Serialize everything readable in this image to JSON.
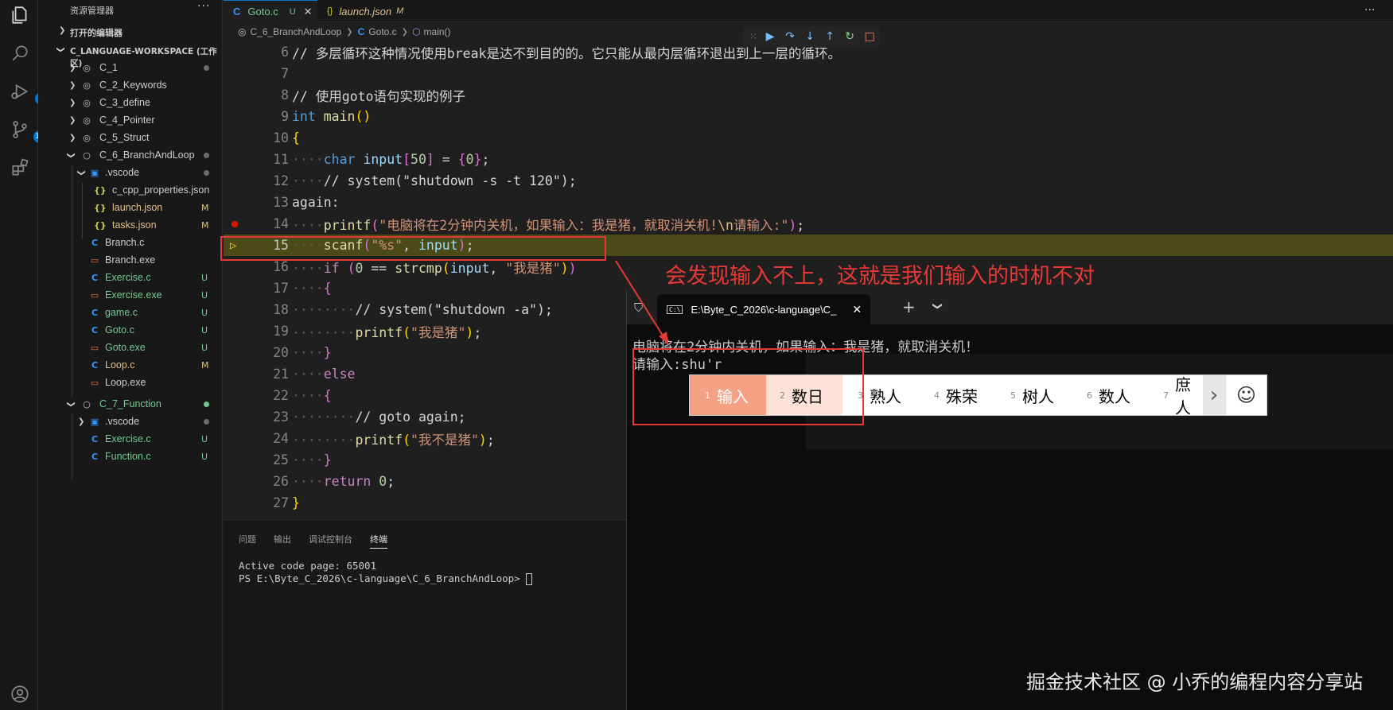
{
  "sidebar": {
    "title": "资源管理器",
    "more": "···",
    "open_editors": "打开的编辑器",
    "workspace": "C_LANGUAGE-WORKSPACE (工作区)",
    "items": [
      {
        "label": "C_1",
        "status": ""
      },
      {
        "label": "C_2_Keywords",
        "status": ""
      },
      {
        "label": "C_3_define",
        "status": ""
      },
      {
        "label": "C_4_Pointer",
        "status": ""
      },
      {
        "label": "C_5_Struct",
        "status": ""
      },
      {
        "label": "C_6_BranchAndLoop",
        "status": ""
      },
      {
        "label": ".vscode",
        "status": ""
      },
      {
        "label": "c_cpp_properties.json",
        "status": ""
      },
      {
        "label": "launch.json",
        "status": "M"
      },
      {
        "label": "tasks.json",
        "status": "M"
      },
      {
        "label": "Branch.c",
        "status": ""
      },
      {
        "label": "Branch.exe",
        "status": ""
      },
      {
        "label": "Exercise.c",
        "status": "U"
      },
      {
        "label": "Exercise.exe",
        "status": "U"
      },
      {
        "label": "game.c",
        "status": "U"
      },
      {
        "label": "Goto.c",
        "status": "U"
      },
      {
        "label": "Goto.exe",
        "status": "U"
      },
      {
        "label": "Loop.c",
        "status": "M"
      },
      {
        "label": "Loop.exe",
        "status": ""
      },
      {
        "label": "C_7_Function",
        "status": ""
      },
      {
        "label": ".vscode",
        "status": ""
      },
      {
        "label": "Exercise.c",
        "status": "U"
      },
      {
        "label": "Function.c",
        "status": "U"
      }
    ]
  },
  "activity": {
    "debug_badge": "1",
    "scm_badge": "15"
  },
  "tabs": [
    {
      "label": "Goto.c",
      "status": "U"
    },
    {
      "label": "launch.json",
      "status": "M"
    }
  ],
  "breadcrumb": {
    "folder": "C_6_BranchAndLoop",
    "file": "Goto.c",
    "symbol": "main()"
  },
  "code": [
    {
      "ln": "6",
      "text": "// 多层循环这种情况使用break是达不到目的的。它只能从最内层循环退出到上一层的循环。"
    },
    {
      "ln": "7",
      "text": ""
    },
    {
      "ln": "8",
      "text": "// 使用goto语句实现的例子"
    },
    {
      "ln": "9",
      "text": "int main()"
    },
    {
      "ln": "10",
      "text": "{"
    },
    {
      "ln": "11",
      "text": "    char input[50] = {0};"
    },
    {
      "ln": "12",
      "text": "    // system(\"shutdown -s -t 120\");"
    },
    {
      "ln": "13",
      "text": "again:"
    },
    {
      "ln": "14",
      "text": "    printf(\"电脑将在2分钟内关机，如果输入：我是猪，就取消关机!\\n请输入:\");"
    },
    {
      "ln": "15",
      "text": "    scanf(\"%s\", input);"
    },
    {
      "ln": "16",
      "text": "    if (0 == strcmp(input, \"我是猪\"))"
    },
    {
      "ln": "17",
      "text": "    {"
    },
    {
      "ln": "18",
      "text": "        // system(\"shutdown -a\");"
    },
    {
      "ln": "19",
      "text": "        printf(\"我是猪\");"
    },
    {
      "ln": "20",
      "text": "    }"
    },
    {
      "ln": "21",
      "text": "    else"
    },
    {
      "ln": "22",
      "text": "    {"
    },
    {
      "ln": "23",
      "text": "        // goto again;"
    },
    {
      "ln": "24",
      "text": "        printf(\"我不是猪\");"
    },
    {
      "ln": "25",
      "text": "    }"
    },
    {
      "ln": "26",
      "text": "    return 0;"
    },
    {
      "ln": "27",
      "text": "}"
    }
  ],
  "panel": {
    "tabs": [
      "问题",
      "输出",
      "调试控制台",
      "终端"
    ],
    "lines": [
      "Active code page: 65001",
      "PS E:\\Byte_C_2026\\c-language\\C_6_BranchAndLoop> "
    ]
  },
  "terminal_window": {
    "tab_title": "E:\\Byte_C_2026\\c-language\\C_",
    "tab_icon": "C:\\",
    "line1": "电脑将在2分钟内关机，如果输入：我是猪，就取消关机！",
    "line2": "请输入:shu'r"
  },
  "ime": {
    "candidates": [
      {
        "num": "1",
        "text": "输入"
      },
      {
        "num": "2",
        "text": "数日"
      },
      {
        "num": "3",
        "text": "熟人"
      },
      {
        "num": "4",
        "text": "殊荣"
      },
      {
        "num": "5",
        "text": "树人"
      },
      {
        "num": "6",
        "text": "数人"
      },
      {
        "num": "7",
        "text": "庶人"
      }
    ]
  },
  "annotation": "会发现输入不上，这就是我们输入的时机不对",
  "watermark": "掘金技术社区 @ 小乔的编程内容分享站",
  "colors": {
    "accent": "#0078d4",
    "annotation_red": "#e53935",
    "ime_selected": "#f4a184"
  }
}
